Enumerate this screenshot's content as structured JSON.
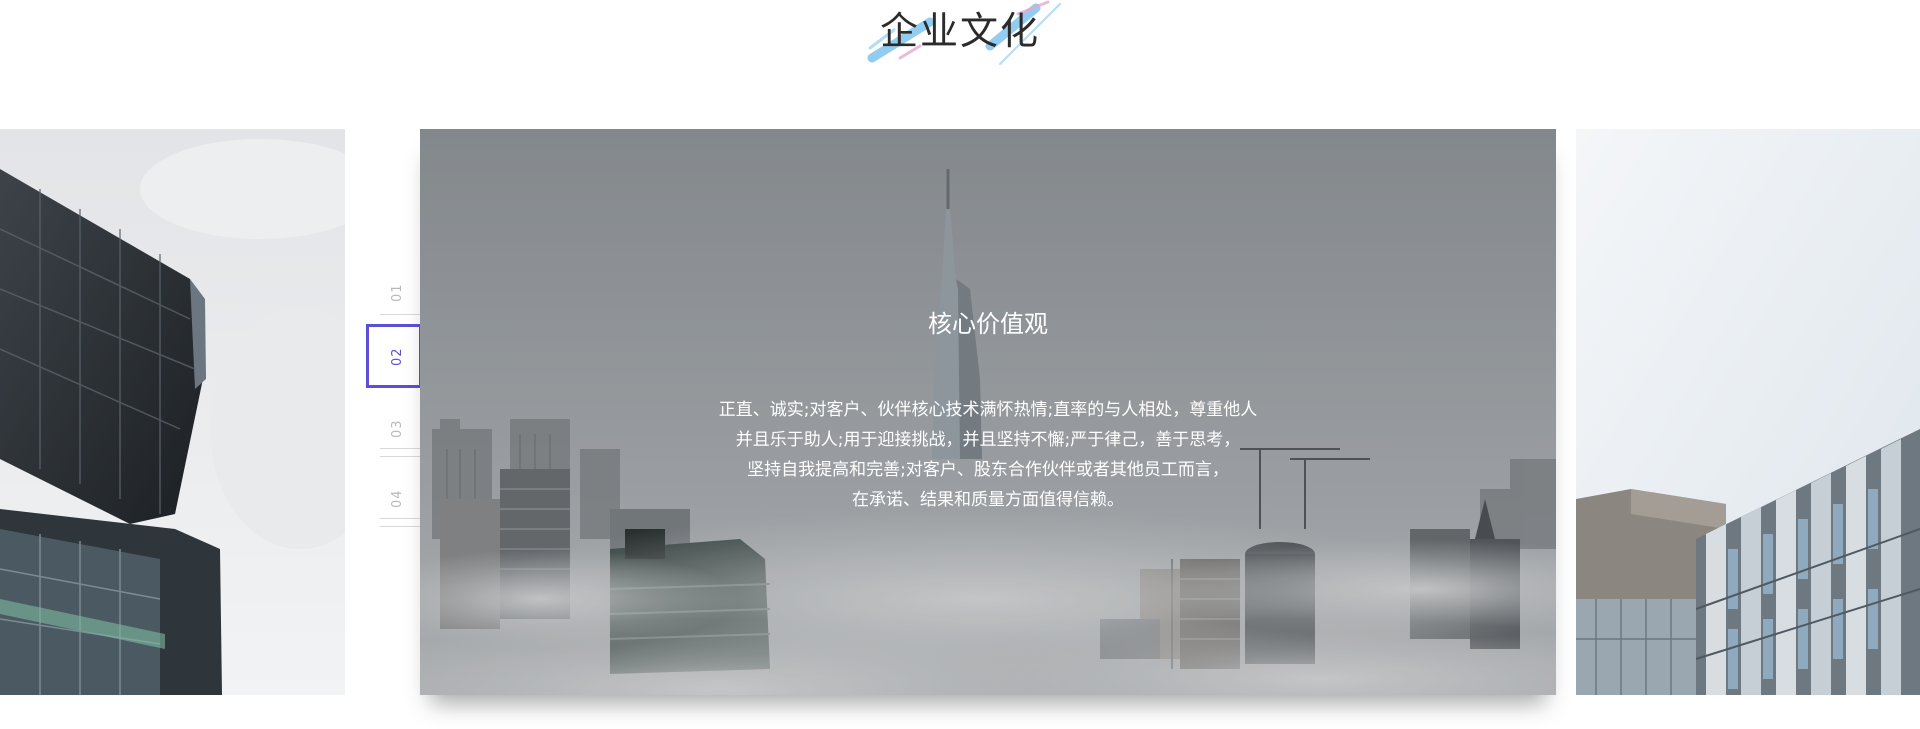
{
  "section": {
    "title": "企业文化"
  },
  "slide": {
    "heading": "核心价值观",
    "lines": [
      "正直、诚实;对客户、伙伴核心技术满怀热情;直率的与人相处，尊重他人",
      "并且乐于助人;用于迎接挑战，并且坚持不懈;严于律己，善于思考，",
      "坚持自我提高和完善;对客户、股东合作伙伴或者其他员工而言，",
      "在承诺、结果和质量方面值得信赖。"
    ]
  },
  "pager": {
    "items": [
      "01",
      "02",
      "03",
      "04"
    ],
    "active_index": 1
  },
  "colors": {
    "accent": "#5b4fd6",
    "title_stroke_blue": "#7fc4ee",
    "title_stroke_pink": "#e8a9d0"
  },
  "icons": {
    "title_decoration": "brush-stroke-decoration"
  }
}
